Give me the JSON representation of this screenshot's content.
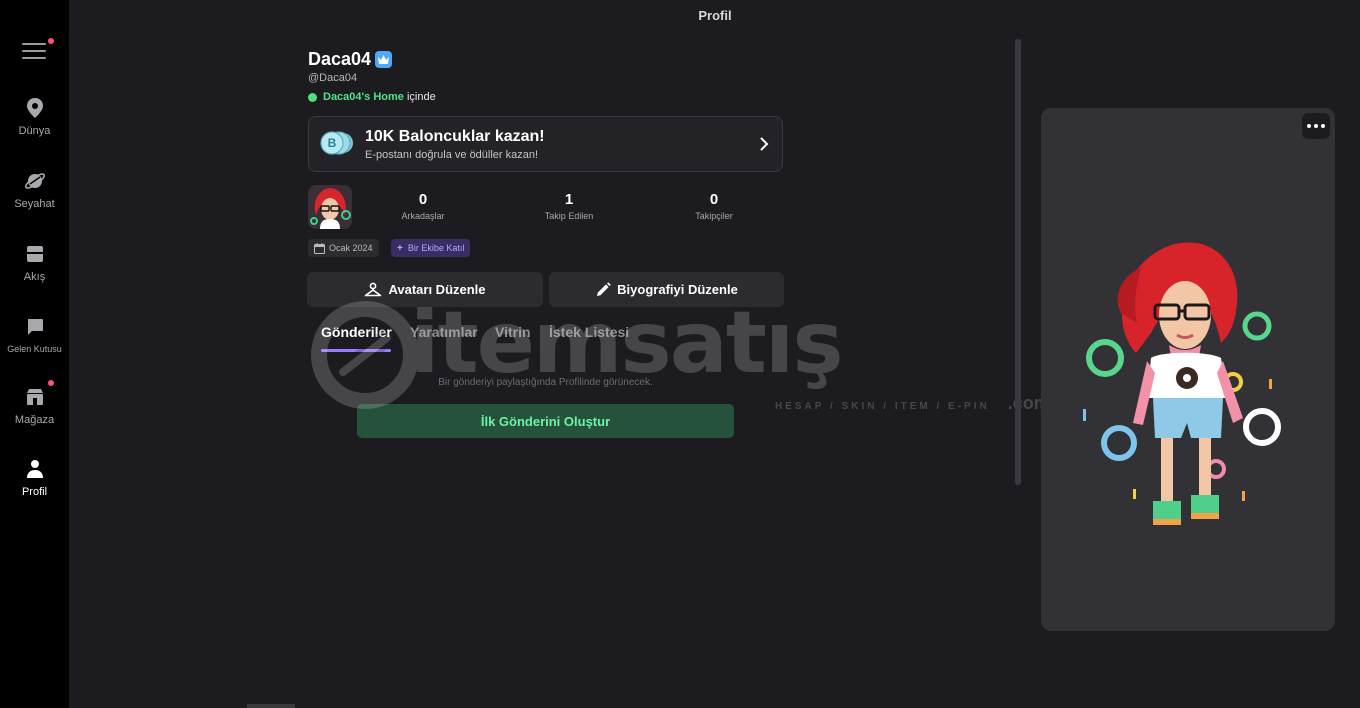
{
  "header": {
    "title": "Profil"
  },
  "sidebar": {
    "menu_icon": "hamburger-icon",
    "items": [
      {
        "label": "Dünya",
        "icon": "map-pin-icon"
      },
      {
        "label": "Seyahat",
        "icon": "planet-icon"
      },
      {
        "label": "Akış",
        "icon": "feed-icon"
      },
      {
        "label": "Gelen Kutusu",
        "icon": "chat-bubble-icon"
      },
      {
        "label": "Mağaza",
        "icon": "store-icon"
      },
      {
        "label": "Profil",
        "icon": "person-icon"
      }
    ]
  },
  "profile": {
    "name": "Daca04",
    "handle": "@Daca04",
    "location_place": "Daca04's Home",
    "location_suffix": "içinde"
  },
  "promo": {
    "title": "10K Baloncuklar kazan!",
    "subtitle": "E-postanı doğrula ve ödüller kazan!",
    "coin_letter": "B"
  },
  "stats": [
    {
      "value": "0",
      "label": "Arkadaşlar"
    },
    {
      "value": "1",
      "label": "Takip Edilen"
    },
    {
      "value": "0",
      "label": "Takipçiler"
    }
  ],
  "chips": {
    "date": "Ocak 2024",
    "team": "Bir Ekibe Katıl"
  },
  "buttons": {
    "edit_avatar": "Avatarı Düzenle",
    "edit_bio": "Biyografiyi Düzenle"
  },
  "tabs": [
    "Gönderiler",
    "Yaratımlar",
    "Vitrin",
    "İstek Listesi"
  ],
  "feed": {
    "empty_text": "Bir gönderiyi paylaştığında Profilinde görünecek.",
    "create_button": "İlk Gönderini Oluştur"
  },
  "watermark": {
    "text": "itemsatış",
    "sub": "HESAP / SKIN / ITEM / E-PIN",
    "suffix": ".com"
  },
  "colors": {
    "accent_purple": "#9b7cff",
    "online_green": "#4be37d",
    "notification_red": "#ff4f7a",
    "verified_blue": "#4fa8f5"
  }
}
